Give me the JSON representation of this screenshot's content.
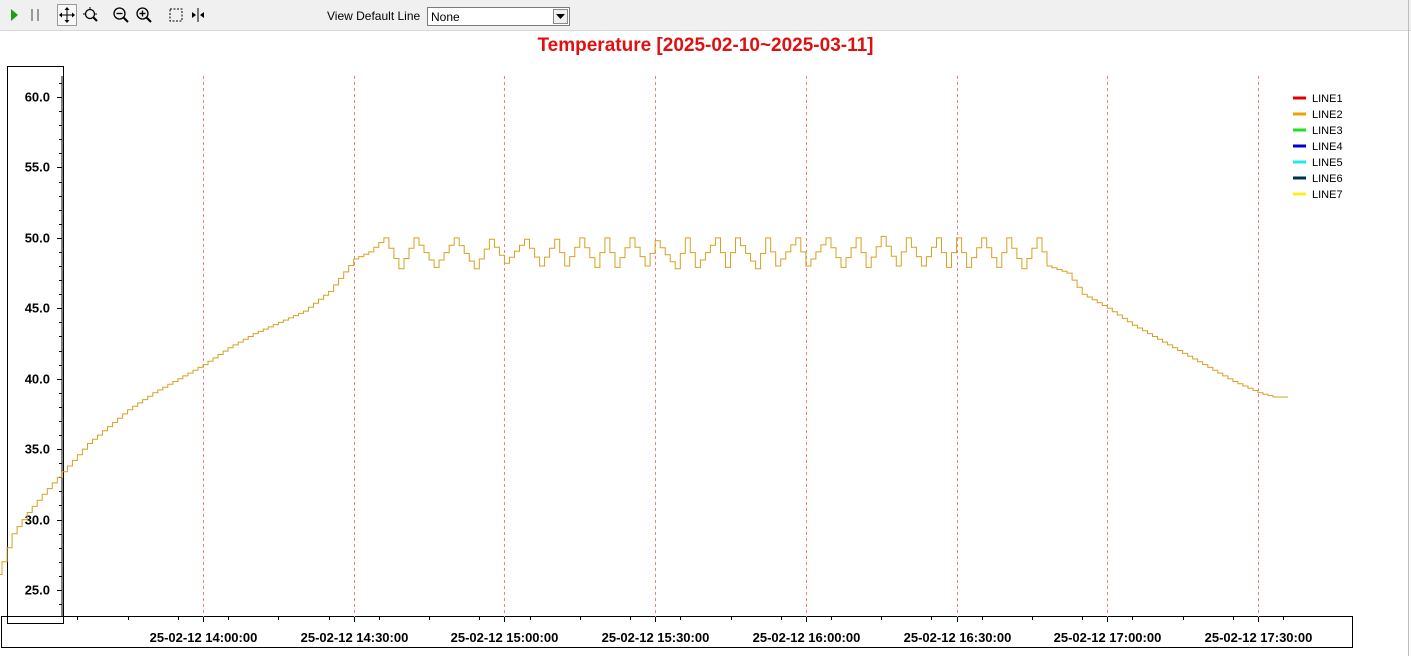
{
  "toolbar": {
    "buttons": [
      {
        "name": "play-icon",
        "color": "#18a018"
      },
      {
        "name": "pause-icon",
        "color": "#9a9a9a"
      },
      {
        "name": "pan-icon",
        "color": "#000000"
      },
      {
        "name": "zoom-reset-icon",
        "color": "#000000"
      },
      {
        "name": "zoom-out-icon",
        "color": "#000000"
      },
      {
        "name": "zoom-in-icon",
        "color": "#000000"
      },
      {
        "name": "select-area-icon",
        "color": "#000000"
      },
      {
        "name": "cursor-line-icon",
        "color": "#000000"
      }
    ],
    "view_label": "View Default Line",
    "view_select": {
      "value": "None"
    }
  },
  "chart_data": {
    "type": "line",
    "title": "Temperature [2025-02-10~2025-03-11]",
    "title_color": "#e01010",
    "xlabel": "",
    "ylabel": "",
    "ylim": [
      23.5,
      62.0
    ],
    "y_ticks": [
      "25.0",
      "30.0",
      "35.0",
      "40.0",
      "45.0",
      "50.0",
      "55.0",
      "60.0"
    ],
    "xlim": [
      "2025-02-12 13:15:00",
      "2025-02-12 17:40:00"
    ],
    "x_ticks": [
      {
        "time": "2025-02-12 14:00:00",
        "label": "25-02-12 14:00:00"
      },
      {
        "time": "2025-02-12 14:30:00",
        "label": "25-02-12 14:30:00"
      },
      {
        "time": "2025-02-12 15:00:00",
        "label": "25-02-12 15:00:00"
      },
      {
        "time": "2025-02-12 15:30:00",
        "label": "25-02-12 15:30:00"
      },
      {
        "time": "2025-02-12 16:00:00",
        "label": "25-02-12 16:00:00"
      },
      {
        "time": "2025-02-12 16:30:00",
        "label": "25-02-12 16:30:00"
      },
      {
        "time": "2025-02-12 17:00:00",
        "label": "25-02-12 17:00:00"
      },
      {
        "time": "2025-02-12 17:30:00",
        "label": "25-02-12 17:30:00"
      }
    ],
    "grid": "vertical dashed red at major x ticks",
    "grid_color": "#f08080",
    "legend_position": "top-right",
    "legend": [
      {
        "name": "LINE1",
        "color": "#e00000"
      },
      {
        "name": "LINE2",
        "color": "#f0a000"
      },
      {
        "name": "LINE3",
        "color": "#20e020"
      },
      {
        "name": "LINE4",
        "color": "#0000d0"
      },
      {
        "name": "LINE5",
        "color": "#20e8f0"
      },
      {
        "name": "LINE6",
        "color": "#003050"
      },
      {
        "name": "LINE7",
        "color": "#f8f020"
      }
    ],
    "series": [
      {
        "name": "LINE2",
        "color": "#d8a020",
        "step": true,
        "x": [
          "2025-02-12 13:16:00",
          "2025-02-12 13:18:00",
          "2025-02-12 13:20:00",
          "2025-02-12 13:22:00",
          "2025-02-12 13:25:00",
          "2025-02-12 13:28:00",
          "2025-02-12 13:31:00",
          "2025-02-12 13:34:00",
          "2025-02-12 13:37:00",
          "2025-02-12 13:41:00",
          "2025-02-12 13:45:00",
          "2025-02-12 13:50:00",
          "2025-02-12 13:55:00",
          "2025-02-12 14:00:00",
          "2025-02-12 14:05:00",
          "2025-02-12 14:10:00",
          "2025-02-12 14:15:00",
          "2025-02-12 14:20:00",
          "2025-02-12 14:25:00",
          "2025-02-12 14:30:00",
          "2025-02-12 14:33:00",
          "2025-02-12 14:36:00",
          "2025-02-12 14:39:00",
          "2025-02-12 14:42:00",
          "2025-02-12 14:46:00",
          "2025-02-12 14:50:00",
          "2025-02-12 14:54:00",
          "2025-02-12 14:57:00",
          "2025-02-12 15:00:00",
          "2025-02-12 15:04:00",
          "2025-02-12 15:07:00",
          "2025-02-12 15:10:00",
          "2025-02-12 15:12:00",
          "2025-02-12 15:15:00",
          "2025-02-12 15:18:00",
          "2025-02-12 15:20:00",
          "2025-02-12 15:22:00",
          "2025-02-12 15:25:00",
          "2025-02-12 15:28:00",
          "2025-02-12 15:30:00",
          "2025-02-12 15:34:00",
          "2025-02-12 15:36:00",
          "2025-02-12 15:38:00",
          "2025-02-12 15:42:00",
          "2025-02-12 15:44:00",
          "2025-02-12 15:46:00",
          "2025-02-12 15:50:00",
          "2025-02-12 15:52:00",
          "2025-02-12 15:54:00",
          "2025-02-12 15:58:00",
          "2025-02-12 16:00:00",
          "2025-02-12 16:04:00",
          "2025-02-12 16:07:00",
          "2025-02-12 16:10:00",
          "2025-02-12 16:12:00",
          "2025-02-12 16:15:00",
          "2025-02-12 16:18:00",
          "2025-02-12 16:20:00",
          "2025-02-12 16:23:00",
          "2025-02-12 16:26:00",
          "2025-02-12 16:28:00",
          "2025-02-12 16:30:00",
          "2025-02-12 16:32:00",
          "2025-02-12 16:35:00",
          "2025-02-12 16:38:00",
          "2025-02-12 16:40:00",
          "2025-02-12 16:43:00",
          "2025-02-12 16:46:00",
          "2025-02-12 16:48:00",
          "2025-02-12 16:52:00",
          "2025-02-12 16:55:00",
          "2025-02-12 17:00:00",
          "2025-02-12 17:05:00",
          "2025-02-12 17:10:00",
          "2025-02-12 17:15:00",
          "2025-02-12 17:20:00",
          "2025-02-12 17:25:00",
          "2025-02-12 17:30:00",
          "2025-02-12 17:33:00",
          "2025-02-12 17:36:00"
        ],
        "y": [
          23.5,
          25.2,
          27.0,
          29.0,
          30.5,
          31.8,
          33.0,
          34.2,
          35.4,
          36.6,
          37.8,
          39.0,
          40.0,
          41.0,
          42.2,
          43.2,
          44.0,
          44.8,
          46.2,
          48.5,
          49.0,
          50.0,
          47.8,
          50.0,
          47.9,
          50.0,
          47.8,
          49.9,
          48.2,
          49.9,
          48.0,
          49.9,
          48.0,
          50.0,
          47.9,
          50.0,
          47.9,
          50.0,
          48.0,
          49.8,
          47.8,
          50.0,
          47.9,
          50.0,
          47.9,
          50.0,
          47.8,
          50.0,
          48.0,
          50.0,
          48.0,
          50.0,
          47.9,
          50.0,
          47.9,
          50.1,
          48.0,
          50.0,
          48.0,
          50.0,
          47.9,
          50.0,
          47.9,
          50.0,
          47.9,
          50.0,
          47.8,
          50.0,
          48.0,
          47.5,
          46.0,
          45.0,
          43.8,
          42.8,
          41.8,
          40.8,
          39.8,
          39.0,
          38.7,
          38.7
        ]
      }
    ]
  }
}
